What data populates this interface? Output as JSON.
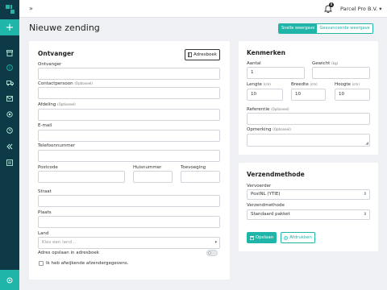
{
  "brand": {
    "accent": "#1fb5a9",
    "sidebar_bg": "#0e3a48"
  },
  "sidebar": {
    "logo_icon": "logo-icon",
    "add_label": "+",
    "items": [
      {
        "icon": "archive-icon"
      },
      {
        "icon": "info-icon"
      },
      {
        "icon": "truck-icon"
      },
      {
        "icon": "mail-icon"
      },
      {
        "icon": "settings-icon"
      },
      {
        "icon": "clock-icon"
      },
      {
        "icon": "chevrons-left-icon"
      },
      {
        "icon": "list-icon"
      }
    ]
  },
  "topbar": {
    "collapse_glyph": "»",
    "notification_count": "8",
    "user_name": "Parcel Pro B.V."
  },
  "page": {
    "title": "Nieuwe zending",
    "views": [
      {
        "label": "Snelle weergave",
        "active": true
      },
      {
        "label": "Geavanceerde weergave",
        "active": false
      }
    ]
  },
  "recipient": {
    "title": "Ontvanger",
    "address_book_label": "Adresboek",
    "fields": {
      "name": {
        "label": "Ontvanger"
      },
      "contact": {
        "label": "Contactpersoon",
        "hint": "(Optioneel)"
      },
      "department": {
        "label": "Afdeling",
        "hint": "(Optioneel)"
      },
      "email": {
        "label": "E-mail"
      },
      "phone": {
        "label": "Telefoonnummer"
      },
      "postcode": {
        "label": "Postcode"
      },
      "house_number": {
        "label": "Huisnummer"
      },
      "addition": {
        "label": "Toevoeging"
      },
      "street": {
        "label": "Straat"
      },
      "city": {
        "label": "Plaats"
      },
      "country": {
        "label": "Land",
        "placeholder": "Kies een land..."
      }
    },
    "save_to_address_book": "Adres opslaan in adresboek",
    "different_sender": "Ik heb afwijkende afzendergegevens."
  },
  "characteristics": {
    "title": "Kenmerken",
    "quantity": {
      "label": "Aantal",
      "value": "1"
    },
    "weight": {
      "label": "Gewicht",
      "unit": "(kg)",
      "value": ""
    },
    "length": {
      "label": "Lengte",
      "unit": "(cm)",
      "value": "10"
    },
    "width": {
      "label": "Breedte",
      "unit": "(cm)",
      "value": "10"
    },
    "height": {
      "label": "Hoogte",
      "unit": "(cm)",
      "value": "10"
    },
    "reference": {
      "label": "Referentie",
      "hint": "(Optioneel)"
    },
    "remark": {
      "label": "Opmerking",
      "hint": "(Optioneel)"
    }
  },
  "shipping": {
    "title": "Verzendmethode",
    "carrier": {
      "label": "Vervoerder",
      "value": "PostNL (YTIE)"
    },
    "method": {
      "label": "Verzendmethode",
      "value": "Standaard pakket"
    },
    "save_label": "Opslaan",
    "print_label": "Afdrukken"
  }
}
